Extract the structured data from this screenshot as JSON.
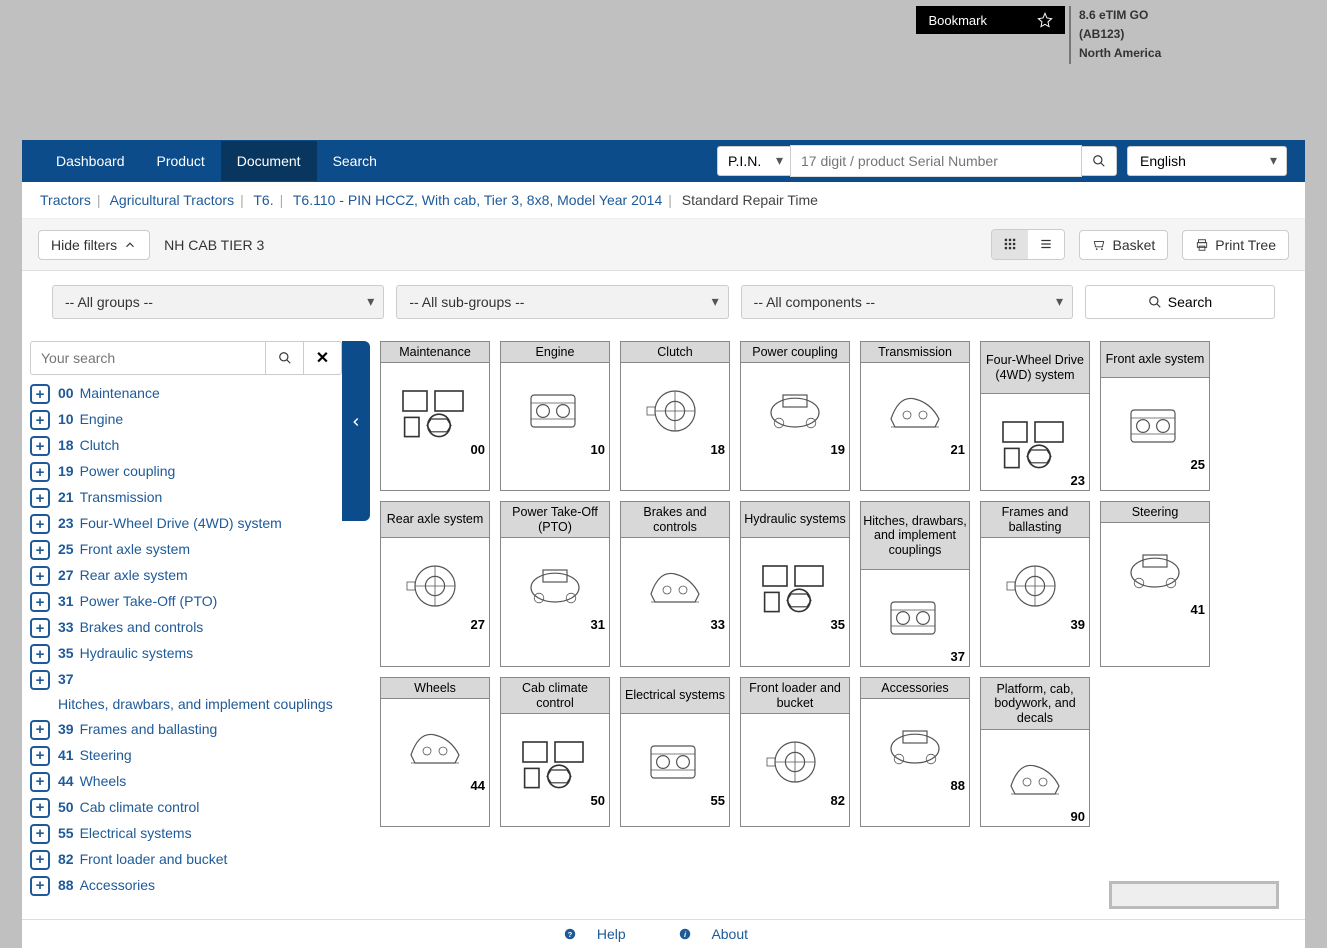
{
  "header": {
    "bookmark": "Bookmark",
    "info_line1": "8.6 eTIM GO",
    "info_line2": "(AB123)",
    "info_line3": "North America"
  },
  "nav": {
    "dashboard": "Dashboard",
    "product": "Product",
    "document": "Document",
    "search": "Search",
    "pin_label": "P.I.N.",
    "serial_placeholder": "17 digit / product Serial Number",
    "language": "English"
  },
  "breadcrumb": {
    "items": [
      "Tractors",
      "Agricultural Tractors",
      "T6.",
      "T6.110 - PIN HCCZ, With cab, Tier 3, 8x8, Model Year 2014",
      "Standard Repair Time"
    ]
  },
  "toolbar": {
    "hide_filters": "Hide filters",
    "title": "NH CAB TIER 3",
    "basket": "Basket",
    "print_tree": "Print Tree"
  },
  "filters": {
    "groups": "-- All groups --",
    "subgroups": "-- All sub-groups --",
    "components": "-- All components --",
    "search": "Search"
  },
  "tree_search_placeholder": "Your search",
  "tree": [
    {
      "code": "00",
      "label": "Maintenance"
    },
    {
      "code": "10",
      "label": "Engine"
    },
    {
      "code": "18",
      "label": "Clutch"
    },
    {
      "code": "19",
      "label": "Power coupling"
    },
    {
      "code": "21",
      "label": "Transmission"
    },
    {
      "code": "23",
      "label": "Four-Wheel Drive (4WD) system"
    },
    {
      "code": "25",
      "label": "Front axle system"
    },
    {
      "code": "27",
      "label": "Rear axle system"
    },
    {
      "code": "31",
      "label": "Power Take-Off (PTO)"
    },
    {
      "code": "33",
      "label": "Brakes and controls"
    },
    {
      "code": "35",
      "label": "Hydraulic systems"
    },
    {
      "code": "37",
      "label": "Hitches, drawbars, and implement couplings"
    },
    {
      "code": "39",
      "label": "Frames and ballasting"
    },
    {
      "code": "41",
      "label": "Steering"
    },
    {
      "code": "44",
      "label": "Wheels"
    },
    {
      "code": "50",
      "label": "Cab climate control"
    },
    {
      "code": "55",
      "label": "Electrical systems"
    },
    {
      "code": "82",
      "label": "Front loader and bucket"
    },
    {
      "code": "88",
      "label": "Accessories"
    }
  ],
  "cards": [
    {
      "label": "Maintenance",
      "num": "00",
      "h": 1
    },
    {
      "label": "Engine",
      "num": "10",
      "h": 1
    },
    {
      "label": "Clutch",
      "num": "18",
      "h": 1
    },
    {
      "label": "Power coupling",
      "num": "19",
      "h": 1
    },
    {
      "label": "Transmission",
      "num": "21",
      "h": 1
    },
    {
      "label": "Four-Wheel Drive (4WD) system",
      "num": "23",
      "h": 3
    },
    {
      "label": "Front axle system",
      "num": "25",
      "h": 2
    },
    {
      "label": "Rear axle system",
      "num": "27",
      "h": 2
    },
    {
      "label": "Power Take-Off (PTO)",
      "num": "31",
      "h": 2
    },
    {
      "label": "Brakes and controls",
      "num": "33",
      "h": 2
    },
    {
      "label": "Hydraulic systems",
      "num": "35",
      "h": 2
    },
    {
      "label": "Hitches, drawbars, and implement couplings",
      "num": "37",
      "h": 4
    },
    {
      "label": "Frames and ballasting",
      "num": "39",
      "h": 2
    },
    {
      "label": "Steering",
      "num": "41",
      "h": 1
    },
    {
      "label": "Wheels",
      "num": "44",
      "h": 1
    },
    {
      "label": "Cab climate control",
      "num": "50",
      "h": 2
    },
    {
      "label": "Electrical systems",
      "num": "55",
      "h": 2
    },
    {
      "label": "Front loader and bucket",
      "num": "82",
      "h": 2
    },
    {
      "label": "Accessories",
      "num": "88",
      "h": 1
    },
    {
      "label": "Platform, cab, bodywork, and decals",
      "num": "90",
      "h": 3
    }
  ],
  "footer": {
    "help": "Help",
    "about": "About"
  }
}
